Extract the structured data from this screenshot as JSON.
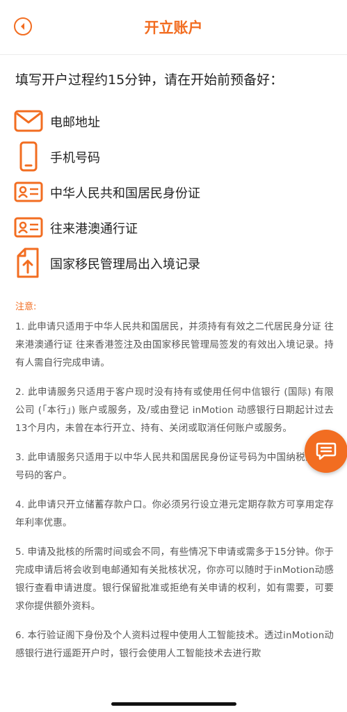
{
  "header": {
    "title": "开立账户",
    "back_icon": "back-arrow-circle-icon"
  },
  "intro": "填写开户过程约15分钟，请在开始前预备好：",
  "requirements": [
    {
      "icon": "email-icon",
      "label": "电邮地址"
    },
    {
      "icon": "mobile-phone-icon",
      "label": "手机号码"
    },
    {
      "icon": "id-card-icon",
      "label": "中华人民共和国居民身份证"
    },
    {
      "icon": "id-card-icon",
      "label": "往来港澳通行证"
    },
    {
      "icon": "document-upload-icon",
      "label": "国家移民管理局出入境记录"
    }
  ],
  "notice": {
    "title": "注意:",
    "items": [
      "1. 此申请只适用于中华人民共和国居民，并须持有有效之二代居民身分证 往来港澳通行证 往来香港签注及由国家移民管理局签发的有效出入境记录。持有人需自行完成申请。",
      "2. 此申请服务只适用于客户现时没有持有或使用任何中信银行 (国际) 有限公司 (「本行」) 账户或服务，及/或由登记 inMotion 动感银行日期起计过去13个月内，未曾在本行开立、持有、关闭或取消任何账户或服务。",
      "3. 此申请服务只适用于以中华人民共和国居民身份证号码为中国纳税人识别号码的客户。",
      "4. 此申请只开立储蓄存款户口。你必须另行设立港元定期存款方可享用定存年利率优惠。",
      "5. 申请及批核的所需时间或会不同，有些情况下申请或需多于15分钟。你于完成申请后将会收到电邮通知有关批核状况，你亦可以随时于inMotion动感银行查看申请进度。银行保留批准或拒绝有关申请的权利，如有需要，可要求你提供额外资料。",
      "6. 本行验证阁下身份及个人资料过程中使用人工智能技术。透过inMotion动感银行进行遥距开户时，银行会使用人工智能技术去进行欺"
    ]
  },
  "chat_button_icon": "chat-bubble-icon",
  "colors": {
    "accent": "#f26d21",
    "text": "#222222",
    "notice_text": "#555555"
  }
}
